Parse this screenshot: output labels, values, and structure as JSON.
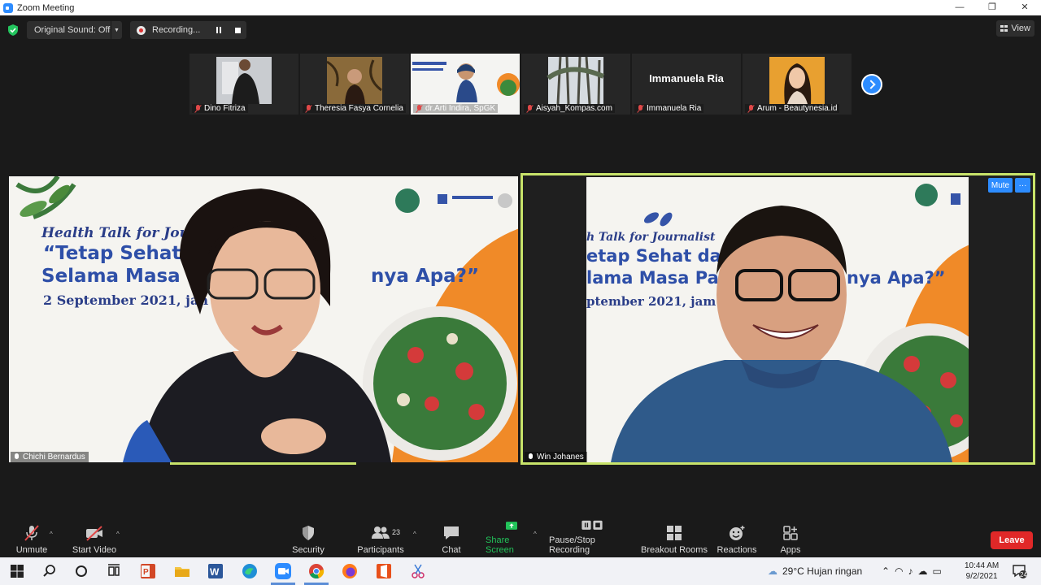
{
  "window": {
    "title": "Zoom Meeting",
    "controls": [
      "—",
      "❐",
      "✕"
    ]
  },
  "topbar": {
    "original_sound": "Original Sound: Off",
    "recording": "Recording...",
    "view": "View"
  },
  "thumbnails": [
    {
      "name": "Dino Fitriza"
    },
    {
      "name": "Theresia Fasya Cornelia"
    },
    {
      "name": "dr.Arti Indira, SpGK"
    },
    {
      "name": "Aisyah_Kompas.com"
    },
    {
      "name": "Immanuela Ria",
      "card_text": "Immanuela Ria"
    },
    {
      "name": "Arum - Beautynesia.id"
    }
  ],
  "speakers": {
    "left": {
      "name": "Chichi Bernardus"
    },
    "right": {
      "name": "Win Johanes"
    }
  },
  "poster_left": {
    "line1": "Health Talk for Journ",
    "line2": "“Tetap Sehat da",
    "line3": "Selama Masa P",
    "line4": "nya Apa?”",
    "line5": "2 September 2021, jan"
  },
  "poster_right": {
    "line1": "h Talk for Journalist",
    "line2": "etap Sehat dan",
    "line3": "lama Masa Pan",
    "line4": "nya Apa?”",
    "line5": "ptember 2021, jam"
  },
  "tile_buttons": {
    "mute": "Mute",
    "more": "···"
  },
  "toolbar": {
    "unmute": "Unmute",
    "start_video": "Start Video",
    "security": "Security",
    "participants": "Participants",
    "participant_count": "23",
    "chat": "Chat",
    "share_screen": "Share Screen",
    "pause_stop_recording": "Pause/Stop Recording",
    "breakout_rooms": "Breakout Rooms",
    "reactions": "Reactions",
    "apps": "Apps",
    "leave": "Leave"
  },
  "taskbar": {
    "weather": "29°C  Hujan ringan",
    "time": "10:44 AM",
    "date": "9/2/2021",
    "notifications": "24"
  },
  "colors": {
    "zoom_blue": "#2d8cff",
    "active_speaker": "#c8e36a",
    "leave_red": "#e02828",
    "share_green": "#22c45a",
    "muted_red": "#e04848"
  }
}
